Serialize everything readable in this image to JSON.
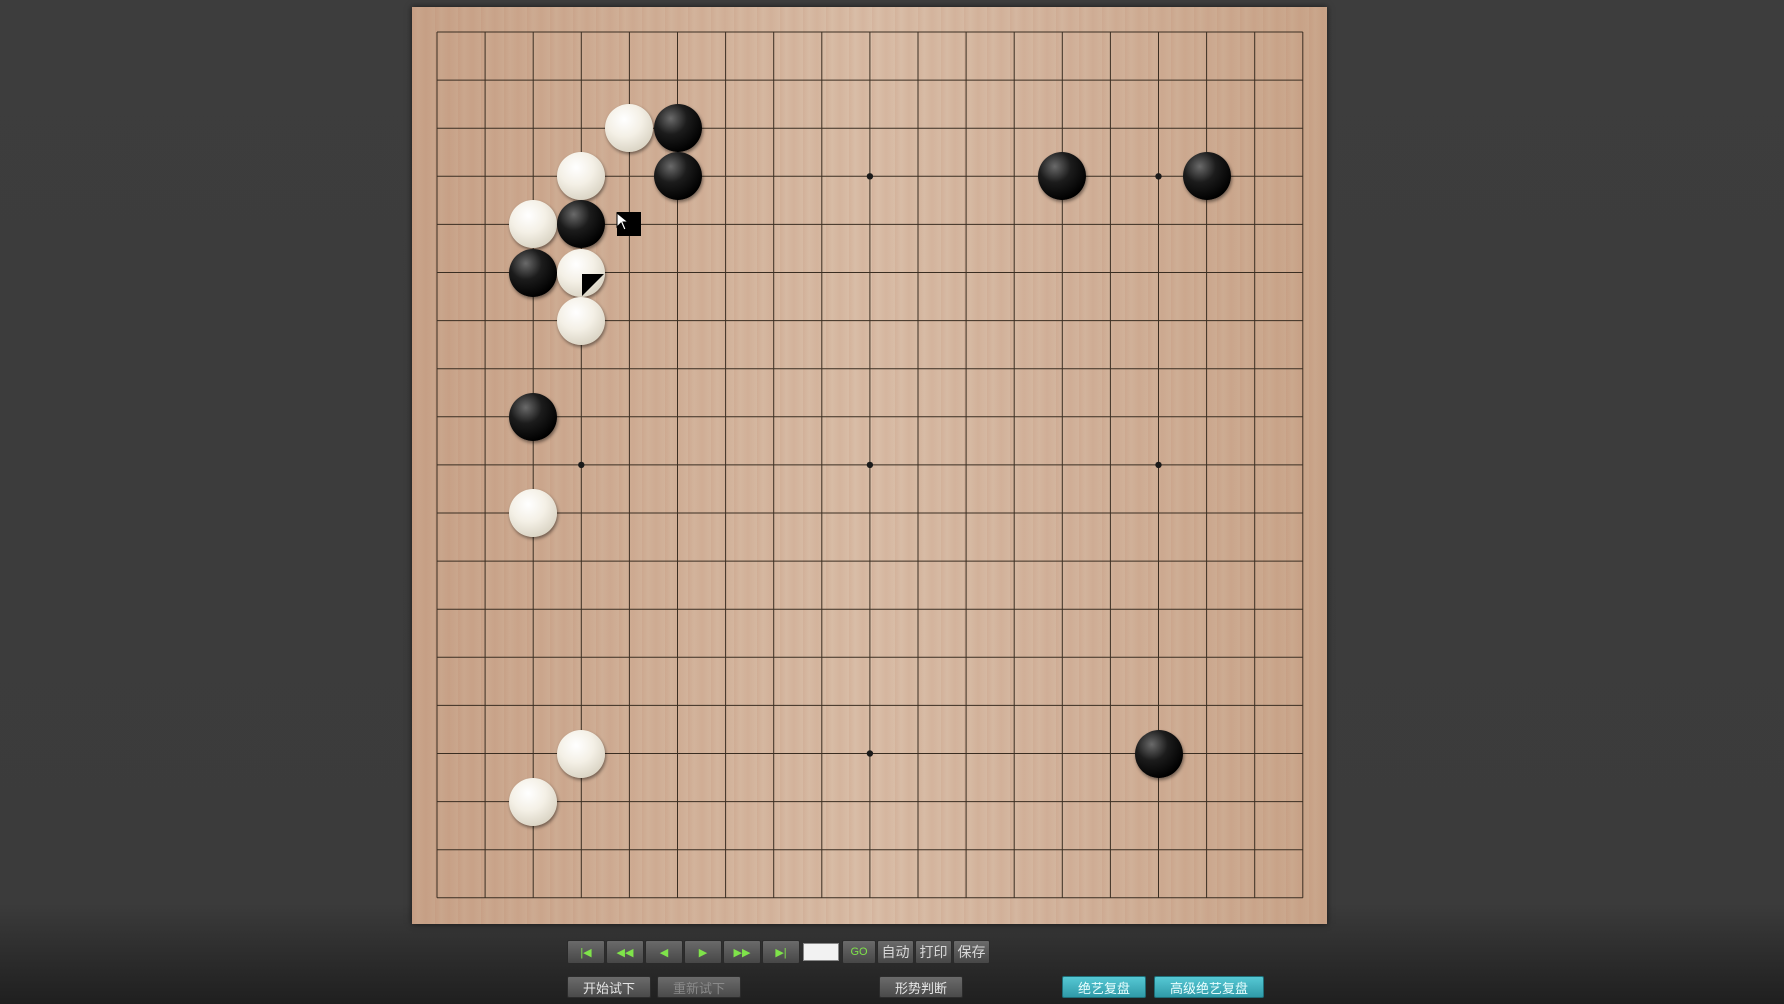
{
  "board": {
    "size": 19,
    "star_points": [
      [
        3,
        3
      ],
      [
        9,
        3
      ],
      [
        15,
        3
      ],
      [
        3,
        9
      ],
      [
        9,
        9
      ],
      [
        15,
        9
      ],
      [
        3,
        15
      ],
      [
        9,
        15
      ],
      [
        15,
        15
      ]
    ],
    "stones": [
      {
        "color": "white",
        "col": 4,
        "row": 2
      },
      {
        "color": "black",
        "col": 5,
        "row": 2
      },
      {
        "color": "white",
        "col": 3,
        "row": 3
      },
      {
        "color": "black",
        "col": 5,
        "row": 3
      },
      {
        "color": "white",
        "col": 2,
        "row": 4
      },
      {
        "color": "black",
        "col": 3,
        "row": 4
      },
      {
        "color": "black",
        "col": 2,
        "row": 5
      },
      {
        "color": "white",
        "col": 3,
        "row": 5
      },
      {
        "color": "white",
        "col": 3,
        "row": 6
      },
      {
        "color": "black",
        "col": 2,
        "row": 8
      },
      {
        "color": "white",
        "col": 2,
        "row": 10
      },
      {
        "color": "white",
        "col": 3,
        "row": 15
      },
      {
        "color": "white",
        "col": 2,
        "row": 16
      },
      {
        "color": "black",
        "col": 13,
        "row": 3
      },
      {
        "color": "black",
        "col": 16,
        "row": 3
      },
      {
        "color": "black",
        "col": 15,
        "row": 15
      }
    ],
    "last_move": {
      "col": 3,
      "row": 5
    },
    "hover_mark": {
      "col": 4,
      "row": 4
    }
  },
  "nav": {
    "first_icon": "skip-to-start-icon",
    "fast_back_icon": "fast-rewind-icon",
    "back_icon": "step-back-icon",
    "forward_icon": "step-forward-icon",
    "fast_forward_icon": "fast-forward-icon",
    "last_icon": "skip-to-end-icon",
    "first": "|◀",
    "fast_back": "◀◀",
    "back": "◀",
    "forward": "▶",
    "fast_forward": "▶▶",
    "last": "▶|",
    "move_value": "",
    "go": "GO",
    "auto": "自动",
    "print": "打印",
    "save": "保存"
  },
  "actions": {
    "start_try": "开始试下",
    "restart_try": "重新试下",
    "judge": "形势判断",
    "ai_review": "绝艺复盘",
    "advanced_ai_review": "高级绝艺复盘"
  },
  "colors": {
    "nav_icon_green": "#7fe34a",
    "cyan_button": "#3fb0bd"
  }
}
